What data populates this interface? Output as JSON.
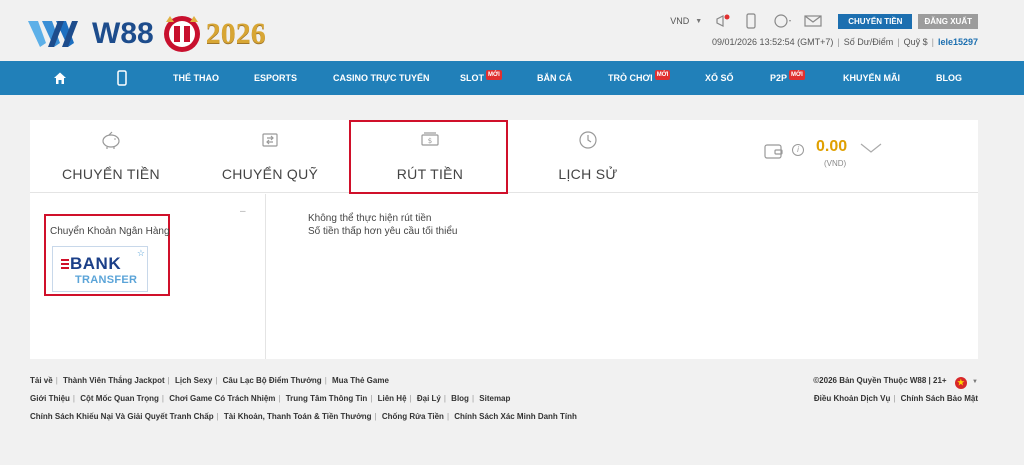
{
  "header": {
    "brand": "W88",
    "year": "2026",
    "currency": "VND",
    "transfer_button": "CHUYỂN TIỀN",
    "logout_button": "ĐĂNG XUẤT",
    "datetime": "09/01/2026 13:52:54 (GMT+7)",
    "balance_link": "Số Dư/Điểm",
    "fund_link": "Quỹ $",
    "username": "lele15297",
    "icons": [
      "megaphone-icon",
      "mobile-icon",
      "circle-icon",
      "mail-icon"
    ]
  },
  "nav": {
    "items": [
      {
        "label": "THỂ THAO",
        "badge": ""
      },
      {
        "label": "ESPORTS",
        "badge": ""
      },
      {
        "label": "CASINO TRỰC TUYẾN",
        "badge": ""
      },
      {
        "label": "SLOT",
        "badge": "MỚI"
      },
      {
        "label": "BẮN CÁ",
        "badge": ""
      },
      {
        "label": "TRÒ CHƠI",
        "badge": "MỚI"
      },
      {
        "label": "XỔ SỐ",
        "badge": ""
      },
      {
        "label": "P2P",
        "badge": "MỚI"
      },
      {
        "label": "KHUYẾN MÃI",
        "badge": ""
      },
      {
        "label": "BLOG",
        "badge": ""
      }
    ]
  },
  "tabs": [
    {
      "label": "CHUYỂN TIỀN",
      "icon": "piggy-bank-icon"
    },
    {
      "label": "CHUYỂN QUỸ",
      "icon": "fund-transfer-icon"
    },
    {
      "label": "RÚT TIỀN",
      "icon": "cash-withdraw-icon",
      "active": true
    },
    {
      "label": "LỊCH SỬ",
      "icon": "history-clock-icon"
    }
  ],
  "wallet": {
    "amount": "0.00",
    "unit": "(VND)",
    "info": "i"
  },
  "method": {
    "title": "Chuyển Khoản Ngân Hàng",
    "collapse": "–",
    "bank_word": "BANK",
    "bank_sub": "TRANSFER"
  },
  "message": {
    "line1": "Không thể thực hiện rút tiền",
    "line2": "Số tiền thấp hơn yêu cầu tối thiểu"
  },
  "footer": {
    "row1": [
      "Tải về",
      "Thành Viên Thắng Jackpot",
      "Lịch Sexy",
      "Câu Lạc Bộ Điểm Thưởng",
      "Mua Thẻ Game"
    ],
    "row2": [
      "Giới Thiệu",
      "Cột Mốc Quan Trọng",
      "Chơi Game Có Trách Nhiệm",
      "Trung Tâm Thông Tin",
      "Liên Hệ",
      "Đại Lý",
      "Blog",
      "Sitemap"
    ],
    "row3": [
      "Chính Sách Khiếu Nại Và Giải Quyết Tranh Chấp",
      "Tài Khoản, Thanh Toán & Tiền Thưởng",
      "Chống Rửa Tiền",
      "Chính Sách Xác Minh Danh Tính"
    ],
    "copyright": "©2026 Bản Quyền Thuộc W88 | 21+",
    "terms": "Điều Khoản Dịch Vụ",
    "privacy": "Chính Sách Bảo Mật"
  },
  "colors": {
    "nav_bg": "#2180b9",
    "highlight": "#d0102a",
    "brand_blue": "#1d4c8c",
    "gold": "#e0a000"
  }
}
